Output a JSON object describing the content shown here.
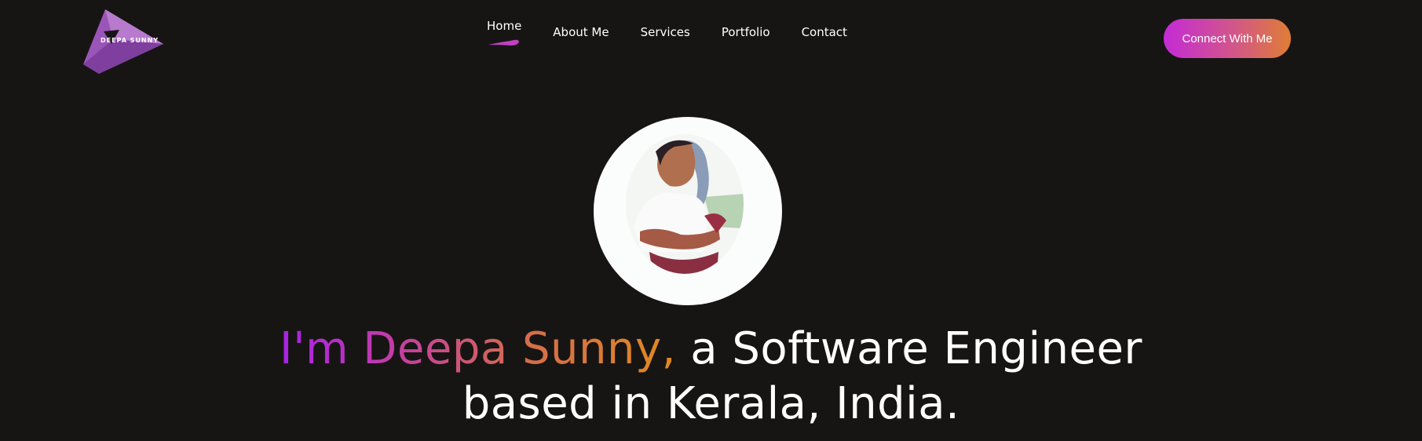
{
  "logo": {
    "text": "DEEPA SUNNY"
  },
  "nav": {
    "items": [
      {
        "label": "Home",
        "active": true
      },
      {
        "label": "About Me"
      },
      {
        "label": "Services"
      },
      {
        "label": "Portfolio"
      },
      {
        "label": "Contact"
      }
    ]
  },
  "cta": {
    "label": "Connect With Me"
  },
  "hero": {
    "name_part": "I'm Deepa Sunny,",
    "rest_line1": " a Software Engineer",
    "line2": "based in Kerala, India."
  },
  "colors": {
    "background": "#171514",
    "accent_purple": "#a922e8",
    "accent_orange": "#e08a1d",
    "logo": "#9a55b8"
  },
  "icons": {
    "logo": "deepa-sunny-logo",
    "nav_active_marker": "brush-stroke-icon"
  }
}
